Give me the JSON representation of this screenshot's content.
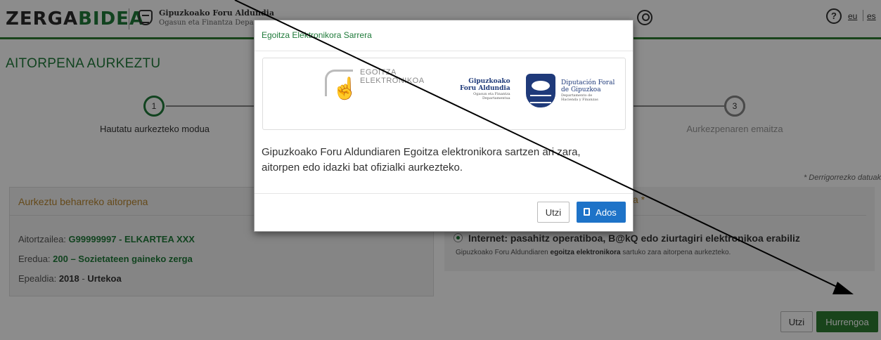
{
  "header": {
    "logo_left": "ZERGA",
    "logo_right": "BIDEA",
    "org_name": "Gipuzkoako Foru Aldundia",
    "org_dept": "Ogasun eta Finantza Depar",
    "help_symbol": "?",
    "lang_eu": "eu",
    "lang_es": "es"
  },
  "page": {
    "title": "AITORPENA AURKEZTU",
    "required_note": "* Derrigorrezko datuak"
  },
  "steps": [
    {
      "number": "1",
      "label": "Hautatu aurkezteko modua"
    },
    {
      "number": "3",
      "label": "Aurkezpenaren emaitza"
    }
  ],
  "left_panel": {
    "title": "Aurkeztu beharreko aitorpena",
    "lines": [
      {
        "label": "Aitortzailea: ",
        "value": "G99999997 - ELKARTEA XXX"
      },
      {
        "label": "Eredua: ",
        "value": "200 – Sozietateen gaineko zerga"
      },
      {
        "label": "Epealdia: ",
        "value": "2018",
        "sep": " - ",
        "value2": "Urtekoa"
      }
    ]
  },
  "right_panel": {
    "title_tail": "a *",
    "option_label": "Internet: pasahitz operatiboa, B@kQ edo ziurtagiri elektronikoa erabiliz",
    "desc_pre": "Gipuzkoako Foru Aldundiaren ",
    "desc_bold": "egoitza elektronikora",
    "desc_post": " sartuko zara aitorpena aurkezteko."
  },
  "footer_buttons": {
    "cancel": "Utzi",
    "next": "Hurrengoa"
  },
  "modal": {
    "title": "Egoitza Elektronikora Sarrera",
    "ego_line1": "EGOITZA",
    "ego_line2": "ELEKTRONIKOA",
    "gfa_left_1": "Gipuzkoako",
    "gfa_left_2": "Foru Aldundia",
    "gfa_left_3": "Ogasun eta Finantza",
    "gfa_left_4": "Departamentua",
    "gfa_right_1": "Diputación Foral",
    "gfa_right_2": "de Gipuzkoa",
    "gfa_right_3": "Departamento de",
    "gfa_right_4": "Hacienda y Finanzas",
    "body": "Gipuzkoako Foru Aldundiaren Egoitza elektronikora sartzen ari zara, aitorpen edo idazki bat ofizialki aurkezteko.",
    "cancel": "Utzi",
    "ok": "Ados"
  }
}
